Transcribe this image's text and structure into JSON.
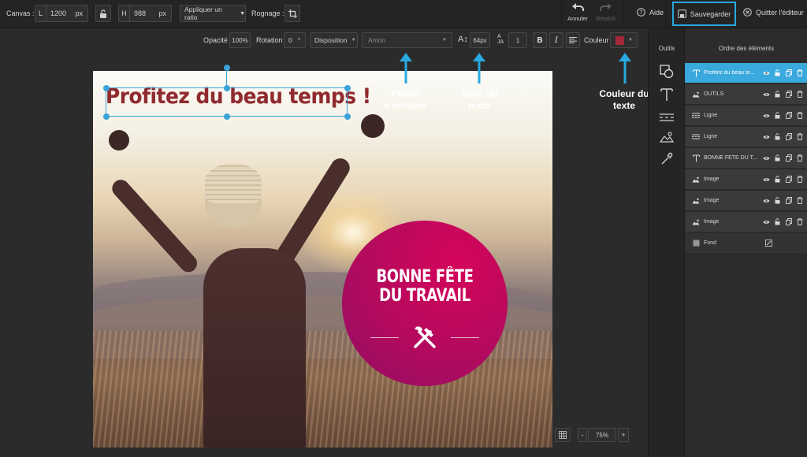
{
  "topbar": {
    "canvas_label": "Canvas :",
    "width_prefix": "L",
    "width_value": "1200",
    "width_unit": "px",
    "height_prefix": "H",
    "height_value": "988",
    "height_unit": "px",
    "ratio_label": "Appliquer un ratio",
    "crop_label": "Rognage :",
    "undo_label": "Annuler",
    "redo_label": "Rétablir",
    "help_label": "Aide",
    "save_label": "Sauvegarder",
    "quit_label": "Quitter l'éditeur",
    "highlight_color": "#2aa8e0"
  },
  "text_toolbar": {
    "opacity_label": "Opacité",
    "opacity_value": "100%",
    "rotation_label": "Rotation",
    "rotation_value": "0",
    "rotation_unit": "°",
    "layout_label": "Disposition",
    "font_value": "Anton",
    "size_value": "64px",
    "line_height_value": "1",
    "bold_label": "B",
    "italic_label": "I",
    "color_label": "Couleur",
    "text_color": "#a3293a"
  },
  "canvas": {
    "title_text": "Profitez du beau temps !",
    "badge_line1": "BONNE FÊTE",
    "badge_line2": "DU TRAVAIL",
    "badge_color": "#c40a5c"
  },
  "annotations": {
    "font_line1": "Police",
    "font_line2": "d'écriture",
    "size_line1": "Taille du",
    "size_line2": "texte",
    "color_line1": "Couleur du",
    "color_line2": "texte",
    "arrow_color": "#2aa8e0"
  },
  "bottom": {
    "zoom_minus": "-",
    "zoom_value": "75%",
    "zoom_plus": "+"
  },
  "tools": {
    "title": "Outils",
    "items": [
      "shapes-icon",
      "text-icon",
      "line-icon",
      "image-icon",
      "eyedropper-icon"
    ]
  },
  "layers": {
    "title": "Ordre des éléments",
    "items": [
      {
        "label": "Profitez du beau te...",
        "icon": "text-icon",
        "active": true
      },
      {
        "label": "OUTILS",
        "icon": "image-icon",
        "active": false
      },
      {
        "label": "Ligne",
        "icon": "line-icon",
        "active": false
      },
      {
        "label": "Ligne",
        "icon": "line-icon",
        "active": false
      },
      {
        "label": "BONNE FÊTE DU T...",
        "icon": "text-icon",
        "active": false
      },
      {
        "label": "Image",
        "icon": "image-icon",
        "active": false
      },
      {
        "label": "Image",
        "icon": "image-icon",
        "active": false
      },
      {
        "label": "Image",
        "icon": "image-icon",
        "active": false
      },
      {
        "label": "Fond",
        "icon": "background-icon",
        "active": false
      }
    ]
  }
}
